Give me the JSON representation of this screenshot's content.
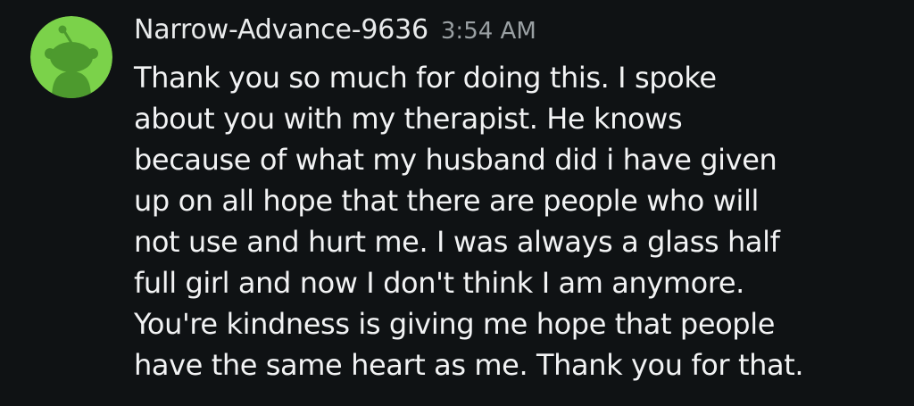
{
  "message": {
    "avatar": {
      "icon": "reddit-snoo-avatar-icon",
      "background_color": "#7bd24a",
      "figure_color": "#4d9a2e"
    },
    "author": "Narrow-Advance-9636",
    "timestamp": "3:54 AM",
    "text": "Thank you so much for doing this. I spoke\nabout you with my therapist. He knows\nbecause of what my husband did i have given\nup on all hope that there are people who will\nnot use and hurt me. I was always a glass half\nfull girl and now I don't think I am anymore.\nYou're kindness is giving me hope that people\nhave the same heart as me. Thank you for that."
  },
  "colors": {
    "background": "#0f1214",
    "text": "#f2f3f4",
    "muted": "#9aa0a3"
  }
}
